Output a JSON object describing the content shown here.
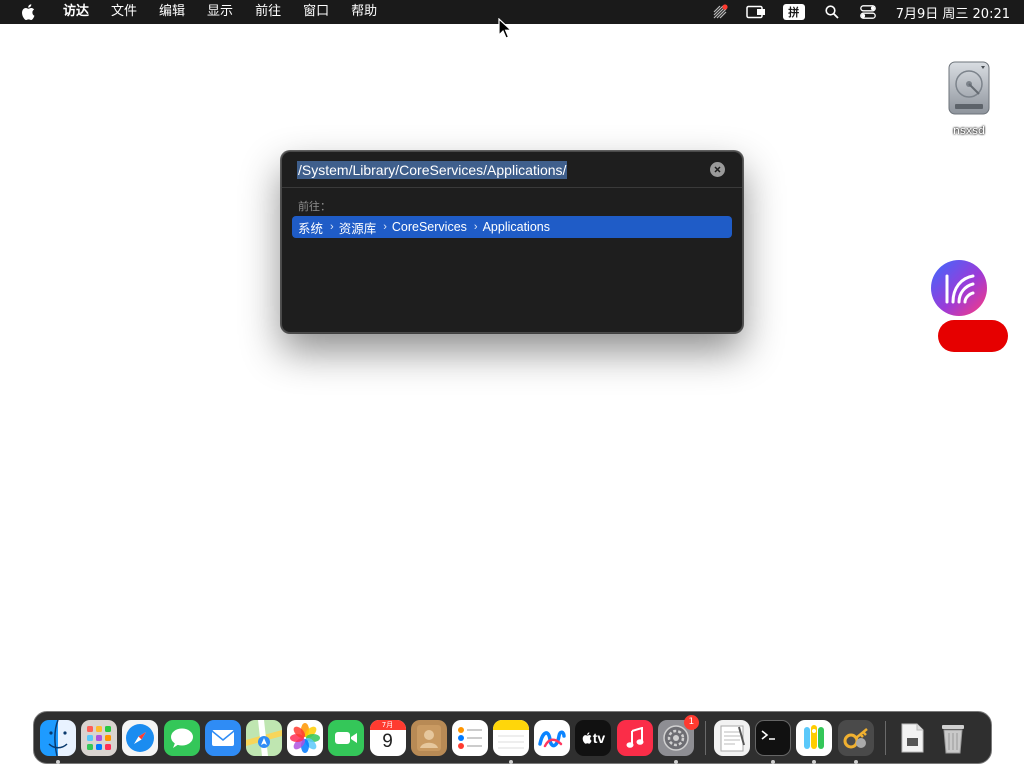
{
  "menubar": {
    "apple_icon": "apple-logo-icon",
    "items": [
      "访达",
      "文件",
      "编辑",
      "显示",
      "前往",
      "窗口",
      "帮助"
    ],
    "status": {
      "ime_label": "拼",
      "clock": "7月9日 周三  20:21"
    }
  },
  "desktop": {
    "disk_label": "nsxsd",
    "app_label": ""
  },
  "goto_dialog": {
    "path": "/System/Library/CoreServices/Applications/",
    "section_label": "前往：",
    "result_crumbs": [
      "系统",
      "资源库",
      "CoreServices",
      "Applications"
    ],
    "crumb_separator": "›"
  },
  "dock": {
    "calendar_month": "7月",
    "calendar_day": "9",
    "settings_badge": "1",
    "tv_label": "tv",
    "apps": [
      {
        "name": "finder",
        "running": true
      },
      {
        "name": "launchpad",
        "running": false
      },
      {
        "name": "safari",
        "running": false
      },
      {
        "name": "messages",
        "running": false
      },
      {
        "name": "mail",
        "running": false
      },
      {
        "name": "maps",
        "running": false
      },
      {
        "name": "photos",
        "running": false
      },
      {
        "name": "facetime",
        "running": false
      },
      {
        "name": "calendar",
        "running": false
      },
      {
        "name": "contacts",
        "running": false
      },
      {
        "name": "reminders",
        "running": false
      },
      {
        "name": "notes",
        "running": true
      },
      {
        "name": "freeform",
        "running": false
      },
      {
        "name": "apple-tv",
        "running": false
      },
      {
        "name": "music",
        "running": false
      },
      {
        "name": "system-settings",
        "running": true
      },
      {
        "name": "textedit",
        "running": false
      },
      {
        "name": "terminal",
        "running": true
      },
      {
        "name": "passwords",
        "running": true
      },
      {
        "name": "keychain-access",
        "running": true
      },
      {
        "name": "downloads",
        "running": false
      },
      {
        "name": "trash",
        "running": false
      }
    ]
  },
  "colors": {
    "menubar_bg": "#1a1a1a",
    "dialog_bg": "#1e1e1e",
    "selection_blue": "#1f5cc7",
    "path_highlight": "#3f5f8c",
    "redaction": "#e60000"
  }
}
